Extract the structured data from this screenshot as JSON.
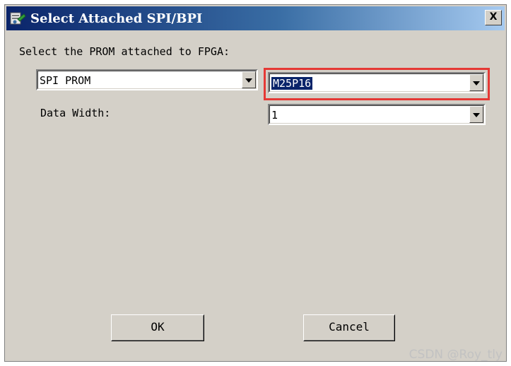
{
  "window": {
    "title": "Select Attached SPI/BPI",
    "close_label": "X"
  },
  "form": {
    "prom_prompt": "Select the PROM attached to FPGA:",
    "prom_type_value": "SPI PROM",
    "prom_part_value": "M25P16",
    "data_width_label": "Data Width:",
    "data_width_value": "1"
  },
  "buttons": {
    "ok_label": "OK",
    "cancel_label": "Cancel"
  },
  "watermark": "CSDN @Roy_tly",
  "colors": {
    "highlight_box": "#e53935",
    "selection": "#0a246a"
  }
}
